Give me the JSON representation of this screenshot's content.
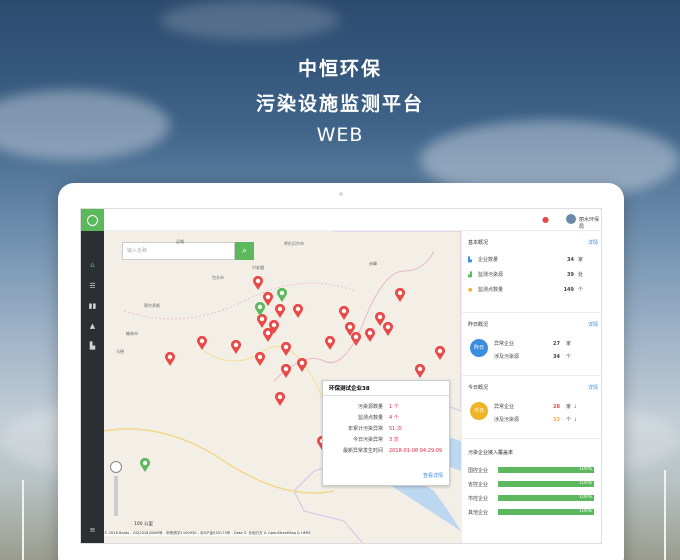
{
  "hero": {
    "line1": "中恒环保",
    "line2": "污染设施监测平台",
    "line3": "WEB"
  },
  "topbar": {
    "username": "丽水环保局",
    "bell_icon": "bell-icon"
  },
  "sidebar": {
    "icons": [
      "home-icon",
      "list-icon",
      "bar-chart-icon",
      "warning-icon",
      "column-chart-icon"
    ]
  },
  "map": {
    "search_placeholder": "输入名称",
    "zoom_scale": "100 公里",
    "copyright": "© 2018 Baidu - GS(2016)2089号 - 甲测资字1100930 - 京ICP证030173号 - Data © 长地万方 & OpenStreetMap & HERE",
    "labels": [
      "运城",
      "呼伦贝尔市",
      "兴安盟",
      "包头市",
      "鄂尔多斯",
      "榆林市",
      "马德",
      "赤峰"
    ],
    "popup": {
      "title": "环保测试企业38",
      "rows": [
        {
          "k": "污染源数量",
          "v": "1 个"
        },
        {
          "k": "监测点数量",
          "v": "4 个"
        },
        {
          "k": "年累计污染异常",
          "v": "51 次"
        },
        {
          "k": "今日污染异常",
          "v": "3 次"
        },
        {
          "k": "最新异常发生时间",
          "v": "2018-01-08 04:29:09"
        }
      ],
      "link": "查看详情"
    }
  },
  "panel": {
    "basic": {
      "title": "基本概况",
      "more": "详情",
      "rows": [
        {
          "label": "企业数量",
          "value": "34",
          "unit": "家"
        },
        {
          "label": "监测污染源",
          "value": "39",
          "unit": "处"
        },
        {
          "label": "监测点数量",
          "value": "149",
          "unit": "个"
        }
      ]
    },
    "yesterday": {
      "title": "昨日概况",
      "more": "详情",
      "badge": "昨日",
      "rows": [
        {
          "label": "异常企业",
          "value": "27",
          "unit": "家"
        },
        {
          "label": "涉及污染源",
          "value": "34",
          "unit": "个"
        }
      ]
    },
    "today": {
      "title": "今日概况",
      "more": "详情",
      "badge": "今日",
      "rows": [
        {
          "label": "异常企业",
          "value": "28",
          "unit": "家"
        },
        {
          "label": "涉及污染源",
          "value": "33",
          "unit": "个"
        }
      ]
    },
    "rate": {
      "title": "污染企业接入覆盖率",
      "bars": [
        {
          "label": "国控企业",
          "pct": "100%"
        },
        {
          "label": "省控企业",
          "pct": "100%"
        },
        {
          "label": "市控企业",
          "pct": "100%"
        },
        {
          "label": "其他企业",
          "pct": "100%"
        }
      ]
    }
  },
  "colors": {
    "brand": "#5cb85c",
    "alert": "#e84a4a",
    "link": "#3b8de0",
    "today": "#f0b429"
  }
}
